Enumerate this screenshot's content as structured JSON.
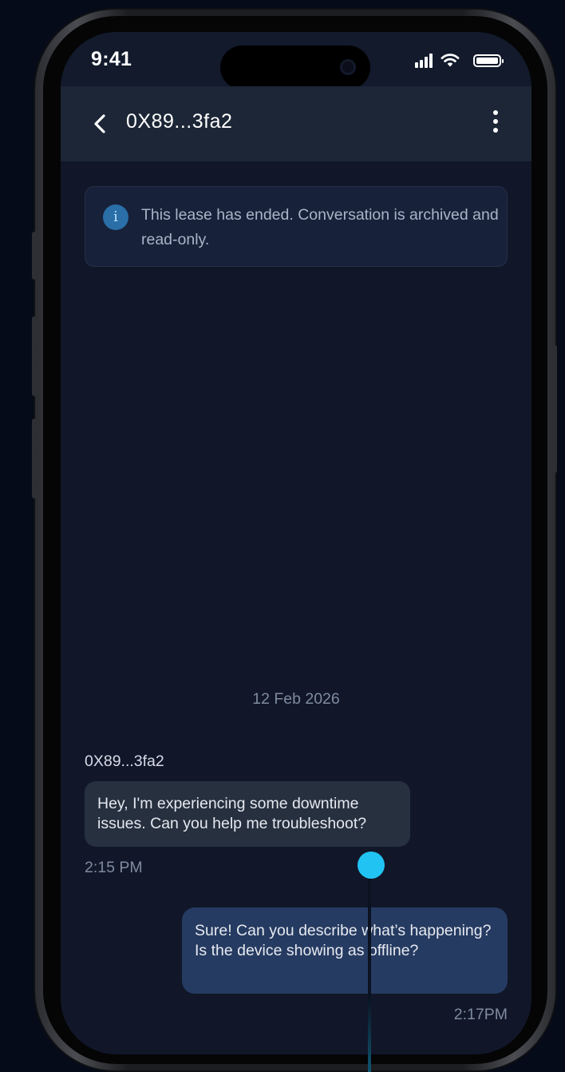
{
  "status_bar": {
    "time": "9:41"
  },
  "header": {
    "title": "0X89...3fa2"
  },
  "notice": {
    "icon": "info-icon",
    "icon_glyph": "i",
    "text": "This lease has ended. Conversation is archived and read-only."
  },
  "chat": {
    "date_separator": "12 Feb 2026",
    "messages": [
      {
        "sender": "0X89...3fa2",
        "direction": "incoming",
        "text": "Hey, I'm experiencing some downtime issues. Can you help me troubleshoot?",
        "time": "2:15 PM"
      },
      {
        "direction": "outgoing",
        "text": "Sure! Can you describe what’s happening? Is the device showing as offline?",
        "time": "2:17PM"
      }
    ]
  },
  "colors": {
    "background": "#050b18",
    "screen": "#111729",
    "header": "#1c2636",
    "incoming_bubble": "#26303f",
    "outgoing_bubble": "#263b61",
    "accent": "#21c3f3"
  }
}
